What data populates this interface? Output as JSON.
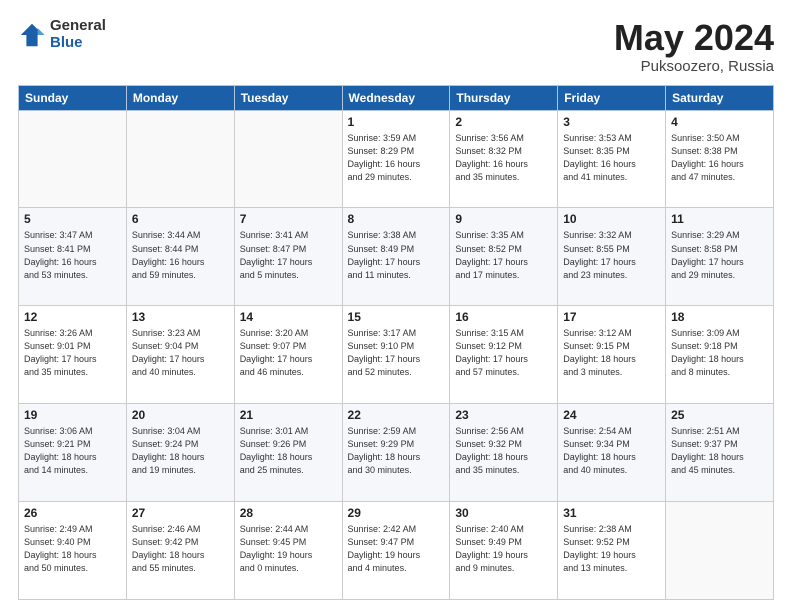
{
  "logo": {
    "general": "General",
    "blue": "Blue"
  },
  "header": {
    "month": "May 2024",
    "location": "Puksoozero, Russia"
  },
  "weekdays": [
    "Sunday",
    "Monday",
    "Tuesday",
    "Wednesday",
    "Thursday",
    "Friday",
    "Saturday"
  ],
  "weeks": [
    [
      {
        "day": "",
        "info": ""
      },
      {
        "day": "",
        "info": ""
      },
      {
        "day": "",
        "info": ""
      },
      {
        "day": "1",
        "info": "Sunrise: 3:59 AM\nSunset: 8:29 PM\nDaylight: 16 hours\nand 29 minutes."
      },
      {
        "day": "2",
        "info": "Sunrise: 3:56 AM\nSunset: 8:32 PM\nDaylight: 16 hours\nand 35 minutes."
      },
      {
        "day": "3",
        "info": "Sunrise: 3:53 AM\nSunset: 8:35 PM\nDaylight: 16 hours\nand 41 minutes."
      },
      {
        "day": "4",
        "info": "Sunrise: 3:50 AM\nSunset: 8:38 PM\nDaylight: 16 hours\nand 47 minutes."
      }
    ],
    [
      {
        "day": "5",
        "info": "Sunrise: 3:47 AM\nSunset: 8:41 PM\nDaylight: 16 hours\nand 53 minutes."
      },
      {
        "day": "6",
        "info": "Sunrise: 3:44 AM\nSunset: 8:44 PM\nDaylight: 16 hours\nand 59 minutes."
      },
      {
        "day": "7",
        "info": "Sunrise: 3:41 AM\nSunset: 8:47 PM\nDaylight: 17 hours\nand 5 minutes."
      },
      {
        "day": "8",
        "info": "Sunrise: 3:38 AM\nSunset: 8:49 PM\nDaylight: 17 hours\nand 11 minutes."
      },
      {
        "day": "9",
        "info": "Sunrise: 3:35 AM\nSunset: 8:52 PM\nDaylight: 17 hours\nand 17 minutes."
      },
      {
        "day": "10",
        "info": "Sunrise: 3:32 AM\nSunset: 8:55 PM\nDaylight: 17 hours\nand 23 minutes."
      },
      {
        "day": "11",
        "info": "Sunrise: 3:29 AM\nSunset: 8:58 PM\nDaylight: 17 hours\nand 29 minutes."
      }
    ],
    [
      {
        "day": "12",
        "info": "Sunrise: 3:26 AM\nSunset: 9:01 PM\nDaylight: 17 hours\nand 35 minutes."
      },
      {
        "day": "13",
        "info": "Sunrise: 3:23 AM\nSunset: 9:04 PM\nDaylight: 17 hours\nand 40 minutes."
      },
      {
        "day": "14",
        "info": "Sunrise: 3:20 AM\nSunset: 9:07 PM\nDaylight: 17 hours\nand 46 minutes."
      },
      {
        "day": "15",
        "info": "Sunrise: 3:17 AM\nSunset: 9:10 PM\nDaylight: 17 hours\nand 52 minutes."
      },
      {
        "day": "16",
        "info": "Sunrise: 3:15 AM\nSunset: 9:12 PM\nDaylight: 17 hours\nand 57 minutes."
      },
      {
        "day": "17",
        "info": "Sunrise: 3:12 AM\nSunset: 9:15 PM\nDaylight: 18 hours\nand 3 minutes."
      },
      {
        "day": "18",
        "info": "Sunrise: 3:09 AM\nSunset: 9:18 PM\nDaylight: 18 hours\nand 8 minutes."
      }
    ],
    [
      {
        "day": "19",
        "info": "Sunrise: 3:06 AM\nSunset: 9:21 PM\nDaylight: 18 hours\nand 14 minutes."
      },
      {
        "day": "20",
        "info": "Sunrise: 3:04 AM\nSunset: 9:24 PM\nDaylight: 18 hours\nand 19 minutes."
      },
      {
        "day": "21",
        "info": "Sunrise: 3:01 AM\nSunset: 9:26 PM\nDaylight: 18 hours\nand 25 minutes."
      },
      {
        "day": "22",
        "info": "Sunrise: 2:59 AM\nSunset: 9:29 PM\nDaylight: 18 hours\nand 30 minutes."
      },
      {
        "day": "23",
        "info": "Sunrise: 2:56 AM\nSunset: 9:32 PM\nDaylight: 18 hours\nand 35 minutes."
      },
      {
        "day": "24",
        "info": "Sunrise: 2:54 AM\nSunset: 9:34 PM\nDaylight: 18 hours\nand 40 minutes."
      },
      {
        "day": "25",
        "info": "Sunrise: 2:51 AM\nSunset: 9:37 PM\nDaylight: 18 hours\nand 45 minutes."
      }
    ],
    [
      {
        "day": "26",
        "info": "Sunrise: 2:49 AM\nSunset: 9:40 PM\nDaylight: 18 hours\nand 50 minutes."
      },
      {
        "day": "27",
        "info": "Sunrise: 2:46 AM\nSunset: 9:42 PM\nDaylight: 18 hours\nand 55 minutes."
      },
      {
        "day": "28",
        "info": "Sunrise: 2:44 AM\nSunset: 9:45 PM\nDaylight: 19 hours\nand 0 minutes."
      },
      {
        "day": "29",
        "info": "Sunrise: 2:42 AM\nSunset: 9:47 PM\nDaylight: 19 hours\nand 4 minutes."
      },
      {
        "day": "30",
        "info": "Sunrise: 2:40 AM\nSunset: 9:49 PM\nDaylight: 19 hours\nand 9 minutes."
      },
      {
        "day": "31",
        "info": "Sunrise: 2:38 AM\nSunset: 9:52 PM\nDaylight: 19 hours\nand 13 minutes."
      },
      {
        "day": "",
        "info": ""
      }
    ]
  ]
}
